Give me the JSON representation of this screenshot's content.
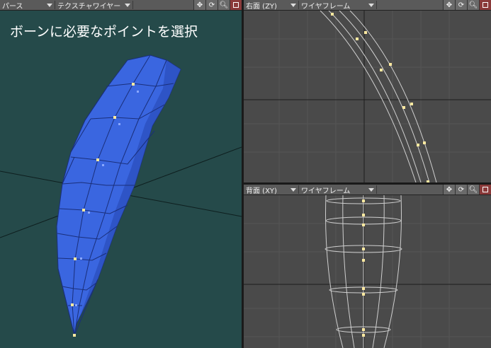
{
  "viewport_persp": {
    "view_mode": "パース",
    "render_mode": "テクスチャワイヤー",
    "title_text": "ボーンに必要なポイントを選択"
  },
  "viewport_right": {
    "view_mode": "右面 (ZY)",
    "render_mode": "ワイヤフレーム"
  },
  "viewport_back": {
    "view_mode": "背面 (XY)",
    "render_mode": "ワイヤフレーム"
  },
  "toolbar_icons": [
    "move-icon",
    "rotate-icon",
    "zoom-icon",
    "maximize-icon"
  ],
  "colors": {
    "persp_bg": "#254a4a",
    "ortho_bg": "#4a4a4a",
    "mesh_fill": "#3a66e0",
    "mesh_edge": "#1a2f7a",
    "point_selected": "#ffe9a0"
  }
}
